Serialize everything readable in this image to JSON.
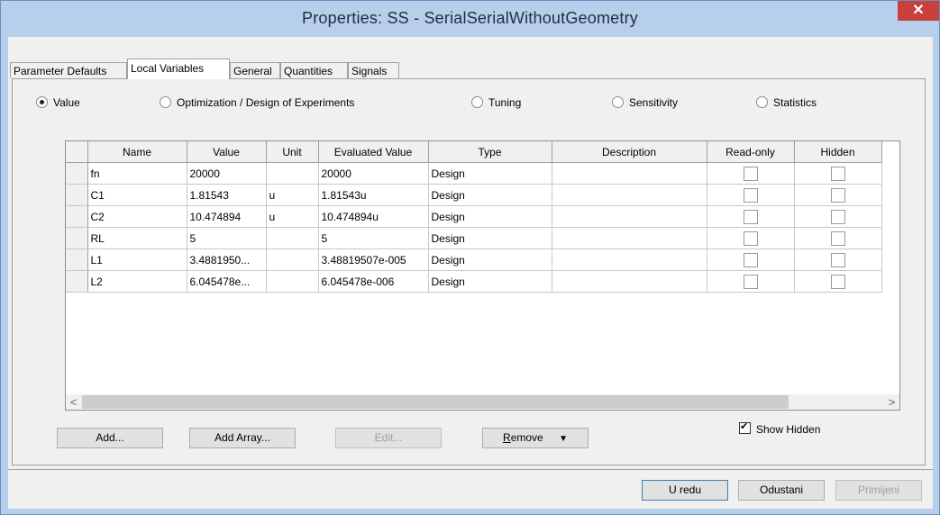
{
  "window": {
    "title": "Properties: SS - SerialSerialWithoutGeometry",
    "close_label": "✕"
  },
  "tabs": [
    "Parameter Defaults",
    "Local Variables",
    "General",
    "Quantities",
    "Signals"
  ],
  "active_tab": "Local Variables",
  "modes": [
    "Value",
    "Optimization / Design of Experiments",
    "Tuning",
    "Sensitivity",
    "Statistics"
  ],
  "selected_mode": "Value",
  "grid": {
    "columns": [
      "Name",
      "Value",
      "Unit",
      "Evaluated Value",
      "Type",
      "Description",
      "Read-only",
      "Hidden"
    ],
    "rows": [
      {
        "name": "fn",
        "value": "20000",
        "unit": "",
        "evaluated": "20000",
        "type": "Design",
        "description": "",
        "readonly": false,
        "hidden": false
      },
      {
        "name": "C1",
        "value": "1.81543",
        "unit": "u",
        "evaluated": "1.81543u",
        "type": "Design",
        "description": "",
        "readonly": false,
        "hidden": false
      },
      {
        "name": "C2",
        "value": "10.474894",
        "unit": "u",
        "evaluated": "10.474894u",
        "type": "Design",
        "description": "",
        "readonly": false,
        "hidden": false
      },
      {
        "name": "RL",
        "value": "5",
        "unit": "",
        "evaluated": "5",
        "type": "Design",
        "description": "",
        "readonly": false,
        "hidden": false
      },
      {
        "name": "L1",
        "value": "3.4881950...",
        "unit": "",
        "evaluated": "3.48819507e-005",
        "type": "Design",
        "description": "",
        "readonly": false,
        "hidden": false
      },
      {
        "name": "L2",
        "value": "6.045478e...",
        "unit": "",
        "evaluated": "6.045478e-006",
        "type": "Design",
        "description": "",
        "readonly": false,
        "hidden": false
      }
    ],
    "scroll_left": "<",
    "scroll_right": ">"
  },
  "buttons": {
    "add": "Add...",
    "add_array": "Add Array...",
    "edit": "Edit...",
    "remove": "Remove",
    "remove_arrow": "▼"
  },
  "show_hidden": {
    "label": "Show Hidden",
    "checked": true
  },
  "footer": {
    "ok": "U redu",
    "cancel": "Odustani",
    "apply": "Primijeni"
  }
}
